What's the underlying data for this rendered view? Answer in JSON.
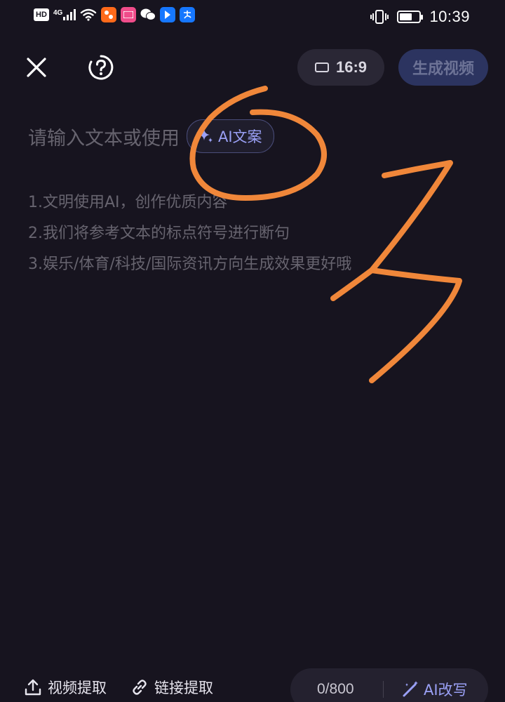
{
  "status_bar": {
    "hd": "HD",
    "network": "4G",
    "time": "10:39",
    "battery_level": 0.65
  },
  "top_bar": {
    "aspect_ratio": "16:9",
    "generate_label": "生成视频"
  },
  "editor": {
    "placeholder": "请输入文本或使用",
    "ai_copy_label": "AI文案",
    "hints": [
      "1.文明使用AI，创作优质内容",
      "2.我们将参考文本的标点符号进行断句",
      "3.娱乐/体育/科技/国际资讯方向生成效果更好哦"
    ]
  },
  "bottom_bar": {
    "extract_video_label": "视频提取",
    "extract_link_label": "链接提取",
    "char_count": "0/800",
    "ai_rewrite_label": "AI改写"
  },
  "colors": {
    "background": "#17141f",
    "accent": "#9aa0f5",
    "annotation": "#f0873a"
  }
}
